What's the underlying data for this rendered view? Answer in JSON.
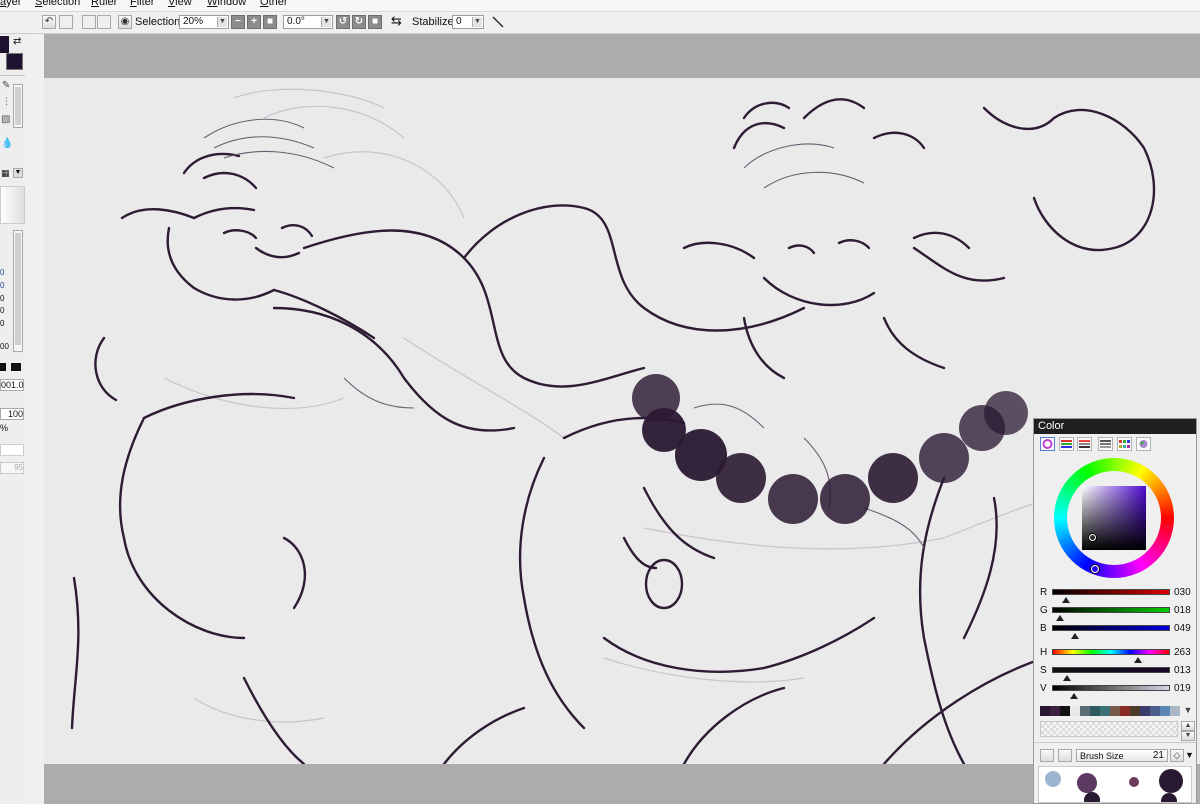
{
  "menu": {
    "items": [
      {
        "id": "layer",
        "label": "ayer"
      },
      {
        "id": "selection",
        "label": "Selection"
      },
      {
        "id": "ruler",
        "label": "Ruler"
      },
      {
        "id": "filter",
        "label": "Filter"
      },
      {
        "id": "view",
        "label": "View"
      },
      {
        "id": "window",
        "label": "Window"
      },
      {
        "id": "other",
        "label": "Other"
      }
    ]
  },
  "toolbar": {
    "selection_label": "Selection",
    "zoom_value": "20%",
    "rotation_value": "0.0°",
    "stabilizer_label": "Stabilizer",
    "stabilizer_value": "0"
  },
  "left_panel": {
    "numbers": [
      "0",
      "0",
      "0",
      "0",
      "0",
      "00"
    ],
    "density_value": "001.0",
    "opacity_value": "100",
    "percent_sign": "%",
    "min_size_value": "95"
  },
  "color_panel": {
    "title": "Color",
    "current_color": "#1e1231",
    "sliders": [
      {
        "label": "R",
        "value": "030",
        "level": 0.118
      },
      {
        "label": "G",
        "value": "018",
        "level": 0.071
      },
      {
        "label": "B",
        "value": "049",
        "level": 0.192
      },
      {
        "label": "H",
        "value": "263",
        "level": 0.73
      },
      {
        "label": "S",
        "value": "013",
        "level": 0.13
      },
      {
        "label": "V",
        "value": "019",
        "level": 0.19
      }
    ],
    "swatches": [
      "#2a1530",
      "#3b2040",
      "#111111",
      "#e8e8e8",
      "#5c6d77",
      "#2e5b62",
      "#3b7277",
      "#7a5b4a",
      "#8a2b26",
      "#4d3b2a",
      "#3a3d6b",
      "#4a5d8d",
      "#5b86b5",
      "#aab7c4"
    ],
    "brush_size_label": "Brush Size",
    "brush_size_value": "21"
  },
  "artwork": {
    "line_color": "#2d1c33",
    "bead_color": "#2a1932"
  }
}
